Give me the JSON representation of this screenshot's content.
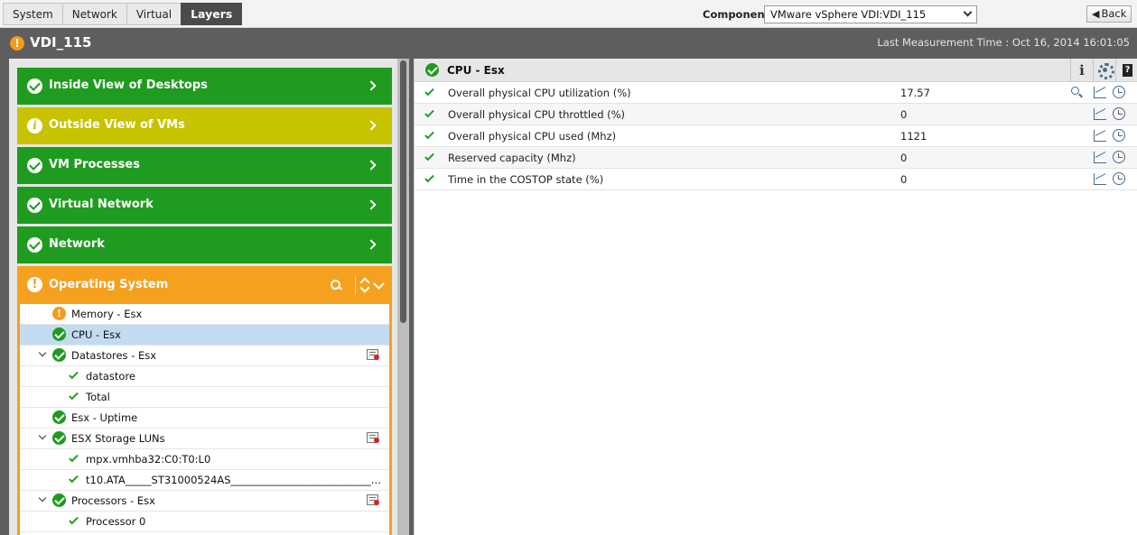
{
  "top_tabs": [
    "System",
    "Network",
    "Virtual",
    "Layers"
  ],
  "active_tab": "Layers",
  "component": {
    "label": "Component",
    "selected": "VMware vSphere VDI:VDI_115"
  },
  "back_label": "Back",
  "page": {
    "title": "VDI_115",
    "last_measurement": "Last Measurement Time : Oct 16, 2014 16:01:05"
  },
  "layers": [
    {
      "label": "Inside View of Desktops",
      "status": "ok"
    },
    {
      "label": "Outside View of VMs",
      "status": "info"
    },
    {
      "label": "VM Processes",
      "status": "ok"
    },
    {
      "label": "Virtual Network",
      "status": "ok"
    },
    {
      "label": "Network",
      "status": "ok"
    }
  ],
  "os_layer": {
    "label": "Operating System",
    "status": "warning",
    "tree": [
      {
        "label": "Memory - Esx",
        "status": "warning",
        "level": 0
      },
      {
        "label": "CPU - Esx",
        "status": "ok",
        "level": 0,
        "selected": true
      },
      {
        "label": "Datastores - Esx",
        "status": "ok",
        "level": 0,
        "expanded": true,
        "config": true
      },
      {
        "label": "datastore",
        "status": "tick",
        "level": 1
      },
      {
        "label": "Total",
        "status": "tick",
        "level": 1
      },
      {
        "label": "Esx - Uptime",
        "status": "ok",
        "level": 0
      },
      {
        "label": "ESX Storage LUNs",
        "status": "ok",
        "level": 0,
        "expanded": true,
        "config": true
      },
      {
        "label": "mpx.vmhba32:C0:T0:L0",
        "status": "tick",
        "level": 1
      },
      {
        "label": "t10.ATA_____ST31000524AS___________________________...",
        "status": "tick",
        "level": 1
      },
      {
        "label": "Processors - Esx",
        "status": "ok",
        "level": 0,
        "expanded": true,
        "config": true
      },
      {
        "label": "Processor 0",
        "status": "tick",
        "level": 1
      }
    ]
  },
  "detail": {
    "title": "CPU - Esx",
    "measures": [
      {
        "name": "Overall physical CPU utilization (%)",
        "value": "17.57",
        "zoom": true
      },
      {
        "name": "Overall physical CPU throttled (%)",
        "value": "0",
        "zoom": false
      },
      {
        "name": "Overall physical CPU used (Mhz)",
        "value": "1121",
        "zoom": false
      },
      {
        "name": "Reserved capacity (Mhz)",
        "value": "0",
        "zoom": false
      },
      {
        "name": "Time in the COSTOP state (%)",
        "value": "0",
        "zoom": false
      }
    ]
  },
  "colors": {
    "ok_green": "#1f9b1f",
    "info_yellow": "#c8c300",
    "warning_orange": "#f5a11f",
    "selected_row": "#c3dbf1"
  }
}
